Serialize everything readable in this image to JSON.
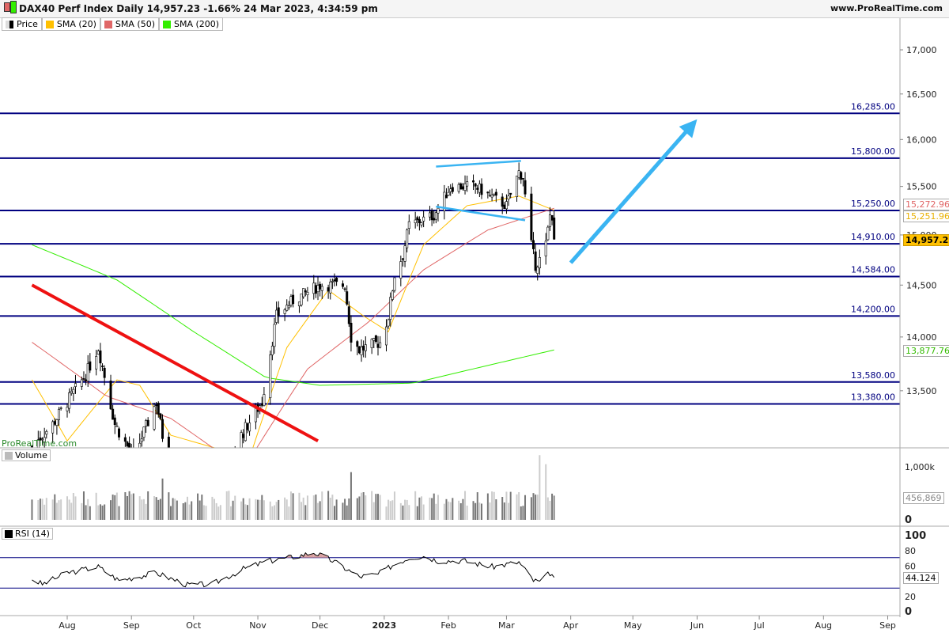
{
  "header": {
    "title": "DAX40 Perf Index Daily 14,957.23 -1.66% 24 Mar 2023, 4:34:59 pm",
    "site": "www.ProRealTime.com",
    "watermark": "ProRealTime.com"
  },
  "legend": [
    {
      "label": "Price",
      "color": "#000000"
    },
    {
      "label": "SMA (20)",
      "color": "#ffc000"
    },
    {
      "label": "SMA (50)",
      "color": "#e06666"
    },
    {
      "label": "SMA (200)",
      "color": "#33ee00"
    }
  ],
  "chart_data": {
    "type": "candlestick",
    "price_axis": {
      "ticks": [
        "17,000",
        "16,500",
        "16,000",
        "15,500",
        "15,000",
        "14,500",
        "14,000",
        "13,500"
      ],
      "tick_values": [
        17000,
        16500,
        16000,
        15500,
        15000,
        14500,
        14000,
        13500
      ],
      "scale": "log"
    },
    "x_ticks": [
      {
        "label": "Aug",
        "date": "2022-08-01"
      },
      {
        "label": "Sep",
        "date": "2022-09-01"
      },
      {
        "label": "Oct",
        "date": "2022-10-01"
      },
      {
        "label": "Nov",
        "date": "2022-11-01"
      },
      {
        "label": "Dec",
        "date": "2022-12-01"
      },
      {
        "label": "2023",
        "date": "2023-01-01"
      },
      {
        "label": "Feb",
        "date": "2023-02-01"
      },
      {
        "label": "Mar",
        "date": "2023-03-01"
      },
      {
        "label": "Apr",
        "date": "2023-04-01"
      },
      {
        "label": "May",
        "date": "2023-05-01"
      },
      {
        "label": "Jun",
        "date": "2023-06-01"
      },
      {
        "label": "Jul",
        "date": "2023-07-01"
      },
      {
        "label": "Aug",
        "date": "2023-08-01"
      },
      {
        "label": "Sep",
        "date": "2023-09-01"
      }
    ],
    "price_anchors": [
      [
        "2022-07-15",
        13000
      ],
      [
        "2022-07-25",
        13200
      ],
      [
        "2022-08-01",
        13400
      ],
      [
        "2022-08-10",
        13650
      ],
      [
        "2022-08-16",
        13900
      ],
      [
        "2022-08-24",
        13200
      ],
      [
        "2022-09-02",
        12900
      ],
      [
        "2022-09-13",
        13400
      ],
      [
        "2022-09-20",
        12700
      ],
      [
        "2022-10-05",
        12300
      ],
      [
        "2022-10-24",
        13100
      ],
      [
        "2022-11-03",
        13400
      ],
      [
        "2022-11-10",
        14200
      ],
      [
        "2022-11-18",
        14350
      ],
      [
        "2022-12-01",
        14500
      ],
      [
        "2022-12-13",
        14500
      ],
      [
        "2022-12-16",
        14000
      ],
      [
        "2022-12-20",
        13880
      ],
      [
        "2022-12-30",
        13950
      ],
      [
        "2023-01-03",
        14200
      ],
      [
        "2023-01-06",
        14600
      ],
      [
        "2023-01-10",
        14800
      ],
      [
        "2023-01-13",
        15100
      ],
      [
        "2023-01-25",
        15200
      ],
      [
        "2023-02-02",
        15500
      ],
      [
        "2023-02-14",
        15500
      ],
      [
        "2023-02-21",
        15400
      ],
      [
        "2023-03-01",
        15300
      ],
      [
        "2023-03-07",
        15650
      ],
      [
        "2023-03-09",
        15600
      ],
      [
        "2023-03-10",
        15400
      ],
      [
        "2023-03-13",
        14900
      ],
      [
        "2023-03-15",
        14700
      ],
      [
        "2023-03-17",
        14750
      ],
      [
        "2023-03-20",
        14900
      ],
      [
        "2023-03-22",
        15200
      ],
      [
        "2023-03-23",
        15200
      ],
      [
        "2023-03-24",
        14957.23
      ]
    ],
    "sma20": [
      [
        "2022-07-15",
        13600
      ],
      [
        "2022-08-01",
        13050
      ],
      [
        "2022-08-25",
        13600
      ],
      [
        "2022-09-05",
        13550
      ],
      [
        "2022-09-20",
        13100
      ],
      [
        "2022-10-28",
        12900
      ],
      [
        "2022-11-15",
        13900
      ],
      [
        "2022-12-05",
        14450
      ],
      [
        "2022-12-22",
        14200
      ],
      [
        "2023-01-03",
        14050
      ],
      [
        "2023-01-20",
        14900
      ],
      [
        "2023-02-10",
        15300
      ],
      [
        "2023-03-07",
        15400
      ],
      [
        "2023-03-24",
        15251.96
      ]
    ],
    "sma50": [
      [
        "2022-07-15",
        13950
      ],
      [
        "2022-08-20",
        13450
      ],
      [
        "2022-09-20",
        13250
      ],
      [
        "2022-10-25",
        12800
      ],
      [
        "2022-11-25",
        13700
      ],
      [
        "2022-12-25",
        14150
      ],
      [
        "2023-01-20",
        14650
      ],
      [
        "2023-02-20",
        15050
      ],
      [
        "2023-03-24",
        15272.96
      ]
    ],
    "sma200": [
      [
        "2022-07-15",
        14900
      ],
      [
        "2022-08-25",
        14550
      ],
      [
        "2022-10-01",
        14050
      ],
      [
        "2022-11-05",
        13620
      ],
      [
        "2022-12-01",
        13550
      ],
      [
        "2023-01-15",
        13570
      ],
      [
        "2023-03-24",
        13877.76
      ]
    ],
    "levels": [
      16285,
      15800,
      15250,
      14910,
      14584,
      14200,
      13580,
      13380
    ],
    "level_labels": [
      "16,285.00",
      "15,800.00",
      "15,250.00",
      "14,910.00",
      "14,584.00",
      "14,200.00",
      "13,580.00",
      "13,380.00"
    ],
    "last_price_label": "14,957.23",
    "sma20_label": "15,251.96",
    "sma50_label": "15,272.96",
    "sma200_label": "13,877.76",
    "trendlines": [
      {
        "name": "downtrend",
        "color": "#ee1111",
        "from": [
          "2022-07-15",
          14500
        ],
        "to": [
          "2022-11-30",
          13050
        ]
      },
      {
        "name": "flag-top",
        "color": "#3ab4f2",
        "from": [
          "2023-01-26",
          15710
        ],
        "to": [
          "2023-03-08",
          15770
        ]
      },
      {
        "name": "flag-bottom",
        "color": "#3ab4f2",
        "from": [
          "2023-01-26",
          15290
        ],
        "to": [
          "2023-03-10",
          15150
        ]
      }
    ],
    "arrow": {
      "color": "#3ab4f2",
      "from": [
        "2023-04-01",
        14720
      ],
      "to": [
        "2023-06-01",
        16220
      ]
    },
    "volume": {
      "label": "Volume",
      "ticks": [
        "1,000k",
        "0"
      ],
      "last": "456,869",
      "spikes": [
        [
          "2022-09-16",
          780
        ],
        [
          "2022-12-16",
          900
        ],
        [
          "2023-03-17",
          1220
        ],
        [
          "2023-03-20",
          1050
        ]
      ]
    },
    "rsi": {
      "label": "RSI (14)",
      "ticks": [
        "100",
        "80",
        "60",
        "20",
        "0"
      ],
      "last": "44.124",
      "levels": [
        70,
        30
      ],
      "anchors": [
        [
          "2022-07-15",
          42
        ],
        [
          "2022-07-20",
          35
        ],
        [
          "2022-08-01",
          50
        ],
        [
          "2022-08-16",
          58
        ],
        [
          "2022-08-26",
          40
        ],
        [
          "2022-09-13",
          50
        ],
        [
          "2022-09-28",
          34
        ],
        [
          "2022-10-10",
          35
        ],
        [
          "2022-10-25",
          55
        ],
        [
          "2022-11-05",
          65
        ],
        [
          "2022-11-20",
          72
        ],
        [
          "2022-11-28",
          77
        ],
        [
          "2022-12-07",
          66
        ],
        [
          "2022-12-20",
          45
        ],
        [
          "2022-12-29",
          48
        ],
        [
          "2023-01-05",
          60
        ],
        [
          "2023-01-13",
          70
        ],
        [
          "2023-01-20",
          72
        ],
        [
          "2023-01-27",
          66
        ],
        [
          "2023-02-08",
          66
        ],
        [
          "2023-02-22",
          58
        ],
        [
          "2023-03-07",
          64
        ],
        [
          "2023-03-14",
          40
        ],
        [
          "2023-03-17",
          38
        ],
        [
          "2023-03-22",
          50
        ],
        [
          "2023-03-24",
          44.124
        ]
      ]
    }
  }
}
